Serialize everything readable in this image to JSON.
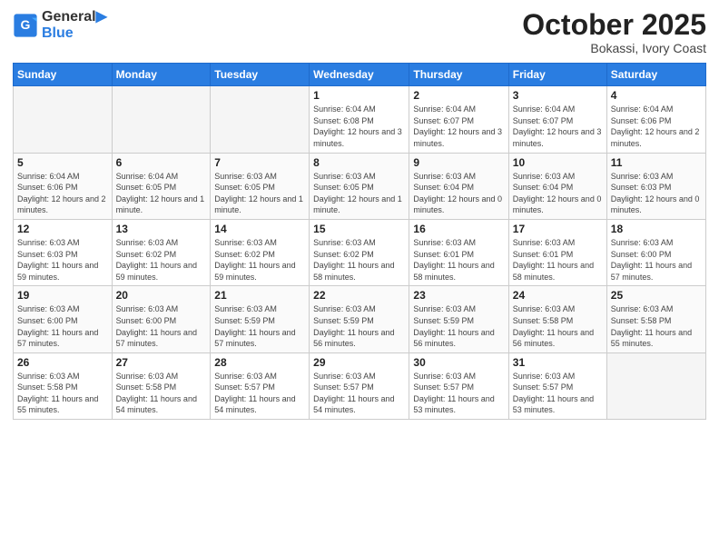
{
  "header": {
    "logo_line1": "General",
    "logo_line2": "Blue",
    "month": "October 2025",
    "location": "Bokassi, Ivory Coast"
  },
  "weekdays": [
    "Sunday",
    "Monday",
    "Tuesday",
    "Wednesday",
    "Thursday",
    "Friday",
    "Saturday"
  ],
  "weeks": [
    [
      {
        "day": "",
        "empty": true
      },
      {
        "day": "",
        "empty": true
      },
      {
        "day": "",
        "empty": true
      },
      {
        "day": "1",
        "sunrise": "6:04 AM",
        "sunset": "6:08 PM",
        "daylight": "12 hours and 3 minutes."
      },
      {
        "day": "2",
        "sunrise": "6:04 AM",
        "sunset": "6:07 PM",
        "daylight": "12 hours and 3 minutes."
      },
      {
        "day": "3",
        "sunrise": "6:04 AM",
        "sunset": "6:07 PM",
        "daylight": "12 hours and 3 minutes."
      },
      {
        "day": "4",
        "sunrise": "6:04 AM",
        "sunset": "6:06 PM",
        "daylight": "12 hours and 2 minutes."
      }
    ],
    [
      {
        "day": "5",
        "sunrise": "6:04 AM",
        "sunset": "6:06 PM",
        "daylight": "12 hours and 2 minutes."
      },
      {
        "day": "6",
        "sunrise": "6:04 AM",
        "sunset": "6:05 PM",
        "daylight": "12 hours and 1 minute."
      },
      {
        "day": "7",
        "sunrise": "6:03 AM",
        "sunset": "6:05 PM",
        "daylight": "12 hours and 1 minute."
      },
      {
        "day": "8",
        "sunrise": "6:03 AM",
        "sunset": "6:05 PM",
        "daylight": "12 hours and 1 minute."
      },
      {
        "day": "9",
        "sunrise": "6:03 AM",
        "sunset": "6:04 PM",
        "daylight": "12 hours and 0 minutes."
      },
      {
        "day": "10",
        "sunrise": "6:03 AM",
        "sunset": "6:04 PM",
        "daylight": "12 hours and 0 minutes."
      },
      {
        "day": "11",
        "sunrise": "6:03 AM",
        "sunset": "6:03 PM",
        "daylight": "12 hours and 0 minutes."
      }
    ],
    [
      {
        "day": "12",
        "sunrise": "6:03 AM",
        "sunset": "6:03 PM",
        "daylight": "11 hours and 59 minutes."
      },
      {
        "day": "13",
        "sunrise": "6:03 AM",
        "sunset": "6:02 PM",
        "daylight": "11 hours and 59 minutes."
      },
      {
        "day": "14",
        "sunrise": "6:03 AM",
        "sunset": "6:02 PM",
        "daylight": "11 hours and 59 minutes."
      },
      {
        "day": "15",
        "sunrise": "6:03 AM",
        "sunset": "6:02 PM",
        "daylight": "11 hours and 58 minutes."
      },
      {
        "day": "16",
        "sunrise": "6:03 AM",
        "sunset": "6:01 PM",
        "daylight": "11 hours and 58 minutes."
      },
      {
        "day": "17",
        "sunrise": "6:03 AM",
        "sunset": "6:01 PM",
        "daylight": "11 hours and 58 minutes."
      },
      {
        "day": "18",
        "sunrise": "6:03 AM",
        "sunset": "6:00 PM",
        "daylight": "11 hours and 57 minutes."
      }
    ],
    [
      {
        "day": "19",
        "sunrise": "6:03 AM",
        "sunset": "6:00 PM",
        "daylight": "11 hours and 57 minutes."
      },
      {
        "day": "20",
        "sunrise": "6:03 AM",
        "sunset": "6:00 PM",
        "daylight": "11 hours and 57 minutes."
      },
      {
        "day": "21",
        "sunrise": "6:03 AM",
        "sunset": "5:59 PM",
        "daylight": "11 hours and 57 minutes."
      },
      {
        "day": "22",
        "sunrise": "6:03 AM",
        "sunset": "5:59 PM",
        "daylight": "11 hours and 56 minutes."
      },
      {
        "day": "23",
        "sunrise": "6:03 AM",
        "sunset": "5:59 PM",
        "daylight": "11 hours and 56 minutes."
      },
      {
        "day": "24",
        "sunrise": "6:03 AM",
        "sunset": "5:58 PM",
        "daylight": "11 hours and 56 minutes."
      },
      {
        "day": "25",
        "sunrise": "6:03 AM",
        "sunset": "5:58 PM",
        "daylight": "11 hours and 55 minutes."
      }
    ],
    [
      {
        "day": "26",
        "sunrise": "6:03 AM",
        "sunset": "5:58 PM",
        "daylight": "11 hours and 55 minutes."
      },
      {
        "day": "27",
        "sunrise": "6:03 AM",
        "sunset": "5:58 PM",
        "daylight": "11 hours and 54 minutes."
      },
      {
        "day": "28",
        "sunrise": "6:03 AM",
        "sunset": "5:57 PM",
        "daylight": "11 hours and 54 minutes."
      },
      {
        "day": "29",
        "sunrise": "6:03 AM",
        "sunset": "5:57 PM",
        "daylight": "11 hours and 54 minutes."
      },
      {
        "day": "30",
        "sunrise": "6:03 AM",
        "sunset": "5:57 PM",
        "daylight": "11 hours and 53 minutes."
      },
      {
        "day": "31",
        "sunrise": "6:03 AM",
        "sunset": "5:57 PM",
        "daylight": "11 hours and 53 minutes."
      },
      {
        "day": "",
        "empty": true
      }
    ]
  ],
  "labels": {
    "sunrise": "Sunrise:",
    "sunset": "Sunset:",
    "daylight": "Daylight:"
  }
}
